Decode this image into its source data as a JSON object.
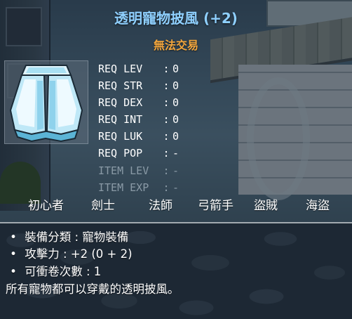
{
  "item": {
    "name": "透明寵物披風 (+2)",
    "trade_status": "無法交易",
    "name_color": "#8fd0ff",
    "trade_color": "#f2a53c"
  },
  "requirements": [
    {
      "label": "REQ LEV",
      "sep": ":",
      "value": "0",
      "dim": false
    },
    {
      "label": "REQ STR",
      "sep": ":",
      "value": "0",
      "dim": false
    },
    {
      "label": "REQ DEX",
      "sep": ":",
      "value": "0",
      "dim": false
    },
    {
      "label": "REQ INT",
      "sep": ":",
      "value": "0",
      "dim": false
    },
    {
      "label": "REQ LUK",
      "sep": ":",
      "value": "0",
      "dim": false
    },
    {
      "label": "REQ POP",
      "sep": ":",
      "value": "-",
      "dim": false
    },
    {
      "label": "ITEM LEV",
      "sep": ":",
      "value": "-",
      "dim": true
    },
    {
      "label": "ITEM EXP",
      "sep": ":",
      "value": "-",
      "dim": true
    }
  ],
  "jobs": [
    "初心者",
    "劍士",
    "法師",
    "弓箭手",
    "盜賊",
    "海盜"
  ],
  "stats": {
    "bullet": "•",
    "rows": [
      "裝備分類 : 寵物裝備",
      "攻擊力 : +2 (0 + 2)",
      "可衝卷次數 : 1"
    ]
  },
  "description": "所有寵物都可以穿戴的透明披風。",
  "icon": "translucent-cape-icon"
}
